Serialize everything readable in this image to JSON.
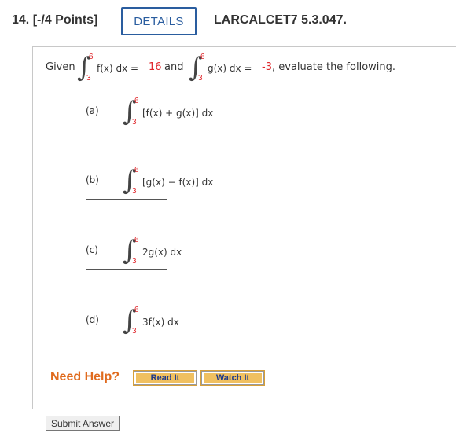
{
  "header": {
    "question_number": "14.",
    "points": "[-/4 Points]",
    "details_label": "DETAILS",
    "problem_code": "LARCALCET7 5.3.047."
  },
  "given": {
    "prefix": "Given",
    "f_integrand": "f(x) dx =",
    "f_value": "16",
    "and_text": "and",
    "g_integrand": "g(x) dx =",
    "g_value": "-3",
    "suffix": ", evaluate the following.",
    "upper_limit": "6",
    "lower_limit": "3"
  },
  "parts": [
    {
      "label": "(a)",
      "expression": "[f(x) + g(x)] dx",
      "upper": "6",
      "lower": "3",
      "answer": ""
    },
    {
      "label": "(b)",
      "expression": "[g(x) − f(x)] dx",
      "upper": "6",
      "lower": "3",
      "answer": ""
    },
    {
      "label": "(c)",
      "expression": "2g(x) dx",
      "upper": "6",
      "lower": "3",
      "answer": ""
    },
    {
      "label": "(d)",
      "expression": "3f(x) dx",
      "upper": "6",
      "lower": "3",
      "answer": ""
    }
  ],
  "help": {
    "label": "Need Help?",
    "read_it": "Read It",
    "watch_it": "Watch It"
  },
  "submit_label": "Submit Answer"
}
